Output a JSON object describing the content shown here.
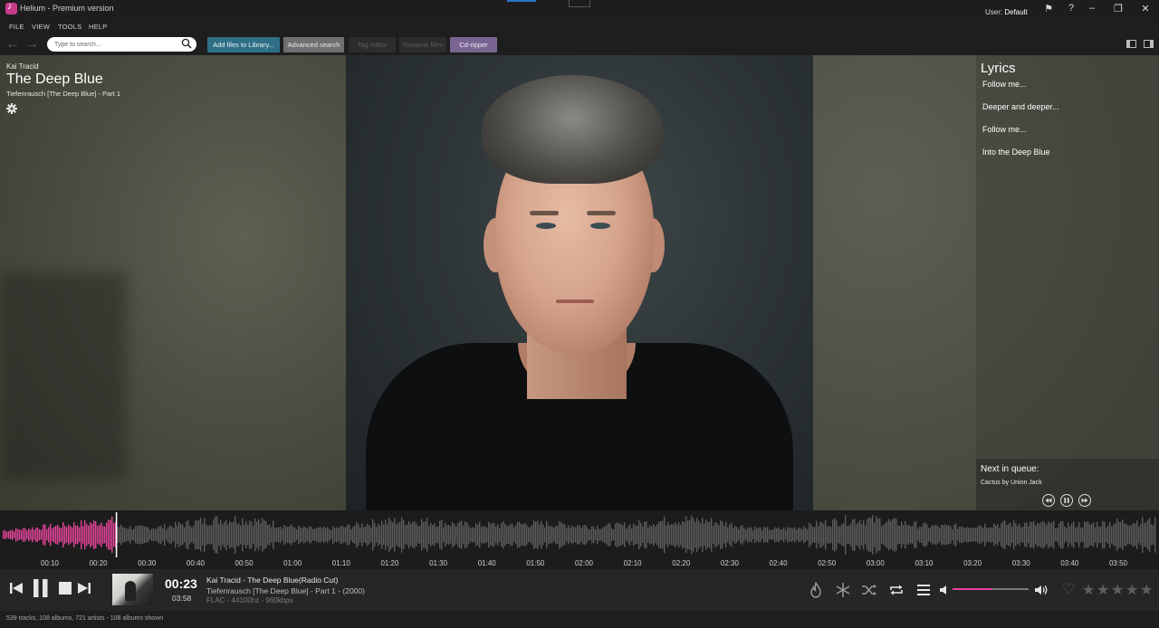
{
  "window": {
    "title": "Helium - Premium version",
    "user_prefix": "User: ",
    "user_name": "Default"
  },
  "menu": [
    "FILE",
    "VIEW",
    "TOOLS",
    "HELP"
  ],
  "toolbar": {
    "search_placeholder": "Type to search...",
    "add_files": "Add files to Library...",
    "advanced_search": "Advanced search",
    "tag_editor": "Tag editor",
    "rename_files": "Rename files",
    "cd_ripper": "Cd-ripper"
  },
  "track": {
    "artist": "Kai Tracid",
    "title": "The Deep Blue",
    "album": "Tiefenrausch [The Deep Blue] - Part 1"
  },
  "lyrics": {
    "title": "Lyrics",
    "lines": [
      "Follow me...",
      "Deeper and deeper...",
      "Follow me...",
      "Into the Deep Blue"
    ]
  },
  "queue": {
    "title": "Next in queue:",
    "item": "Cactus by Union Jack"
  },
  "waveform": {
    "progress_fraction": 0.098,
    "played_color": "#e4459a",
    "unplayed_color": "#5c5c5c",
    "ticks": [
      "00:10",
      "00:20",
      "00:30",
      "00:40",
      "00:50",
      "01:00",
      "01:10",
      "01:20",
      "01:30",
      "01:40",
      "01:50",
      "02:00",
      "02:10",
      "02:20",
      "02:30",
      "02:40",
      "02:50",
      "03:00",
      "03:10",
      "03:20",
      "03:30",
      "03:40",
      "03:50"
    ]
  },
  "player": {
    "current_time": "00:23",
    "total_time": "03:58",
    "now_playing_title": "Kai Tracid - The Deep Blue(Radio Cut)",
    "now_playing_album": "Tiefenrausch [The Deep Blue] - Part 1 - (2000)",
    "format": "FLAC - 44100hz - 960kbps",
    "volume_fraction": 0.52,
    "rating_stars": 0,
    "max_stars": 5
  },
  "status": {
    "summary": "539 tracks, 108 albums, 721 artists - 108 albums shown"
  },
  "colors": {
    "accent": "#e4459a",
    "add_button": "#2f6f86",
    "cd_button": "#7a6592"
  }
}
